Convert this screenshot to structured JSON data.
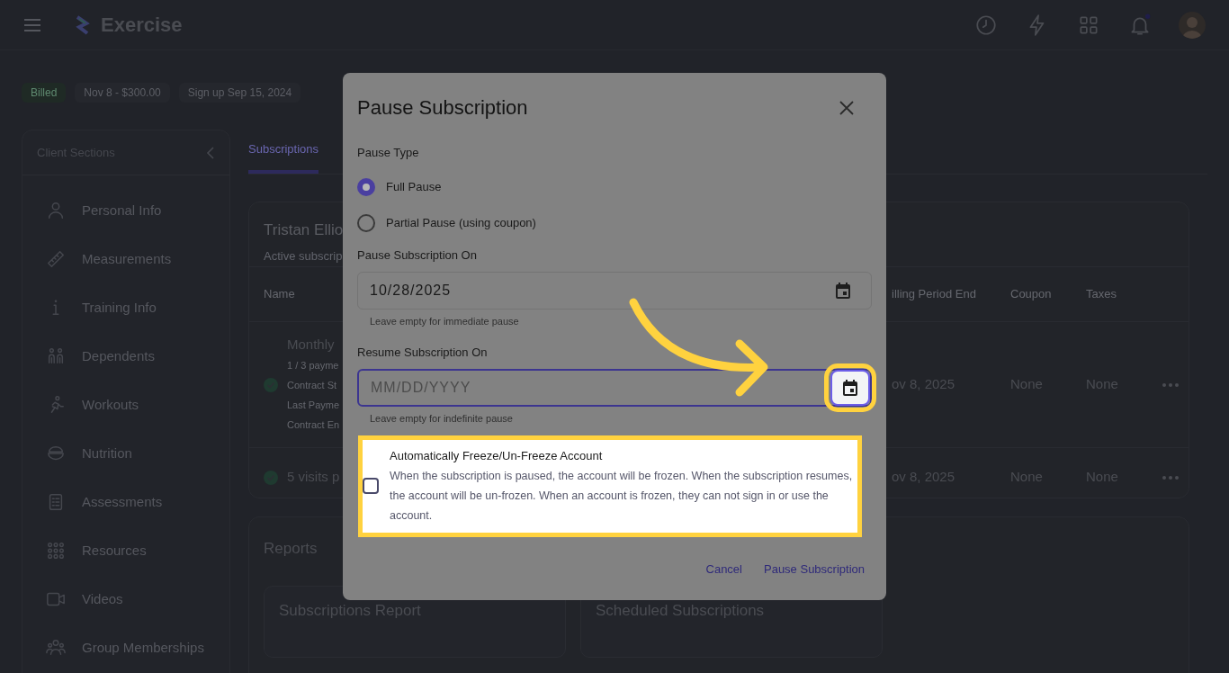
{
  "app": {
    "title": "Exercise"
  },
  "chips": [
    {
      "label": "Billed",
      "kind": "status"
    },
    {
      "label": "Nov 8 - $300.00",
      "kind": "plain"
    },
    {
      "label": "Sign up Sep 15, 2024",
      "kind": "plain"
    }
  ],
  "sidebar": {
    "title": "Client Sections",
    "items": [
      {
        "label": "Personal Info",
        "kind": "person"
      },
      {
        "label": "Measurements",
        "kind": "ruler"
      },
      {
        "label": "Training Info",
        "kind": "info"
      },
      {
        "label": "Dependents",
        "kind": "people"
      },
      {
        "label": "Workouts",
        "kind": "runner"
      },
      {
        "label": "Nutrition",
        "kind": "bowl"
      },
      {
        "label": "Assessments",
        "kind": "clipboard"
      },
      {
        "label": "Resources",
        "kind": "grid"
      },
      {
        "label": "Videos",
        "kind": "video"
      },
      {
        "label": "Group Memberships",
        "kind": "group"
      }
    ]
  },
  "tabs": [
    {
      "label": "Subscriptions",
      "selected": true
    }
  ],
  "client_card": {
    "name": "Tristan Ellio",
    "subtitle": "Active subscrip"
  },
  "table": {
    "columns": [
      "Name",
      "illing Period End",
      "Coupon",
      "Taxes"
    ],
    "rows": [
      {
        "name": "Monthly",
        "details": [
          "1 / 3 payme",
          "Contract St",
          "Last Payme",
          "Contract En"
        ],
        "period_end": "ov 8, 2025",
        "coupon": "None",
        "taxes": "None"
      },
      {
        "name": "5 visits p",
        "details": [],
        "period_end": "ov 8, 2025",
        "coupon": "None",
        "taxes": "None"
      }
    ]
  },
  "reports": {
    "title": "Reports",
    "cards": [
      "Subscriptions Report",
      "Scheduled Subscriptions"
    ]
  },
  "dialog": {
    "title": "Pause Subscription",
    "pause_type": {
      "label": "Pause Type",
      "options": [
        {
          "label": "Full Pause",
          "selected": true
        },
        {
          "label": "Partial Pause (using coupon)",
          "selected": false
        }
      ]
    },
    "pause_on": {
      "label": "Pause Subscription On",
      "value": "10/28/2025",
      "hint": "Leave empty for immediate pause"
    },
    "resume_on": {
      "label": "Resume Subscription On",
      "placeholder": "MM/DD/YYYY",
      "hint": "Leave empty for indefinite pause",
      "focused": true,
      "calendar_highlighted": true
    },
    "freeze": {
      "title": "Automatically Freeze/Un-Freeze Account",
      "description": "When the subscription is paused, the account will be frozen. When the subscription resumes, the account will be un-frozen. When an account is frozen, they can not sign in or use the account.",
      "checked": false,
      "highlighted": true
    },
    "buttons": [
      {
        "label": "Cancel"
      },
      {
        "label": "Pause Subscription"
      }
    ]
  }
}
